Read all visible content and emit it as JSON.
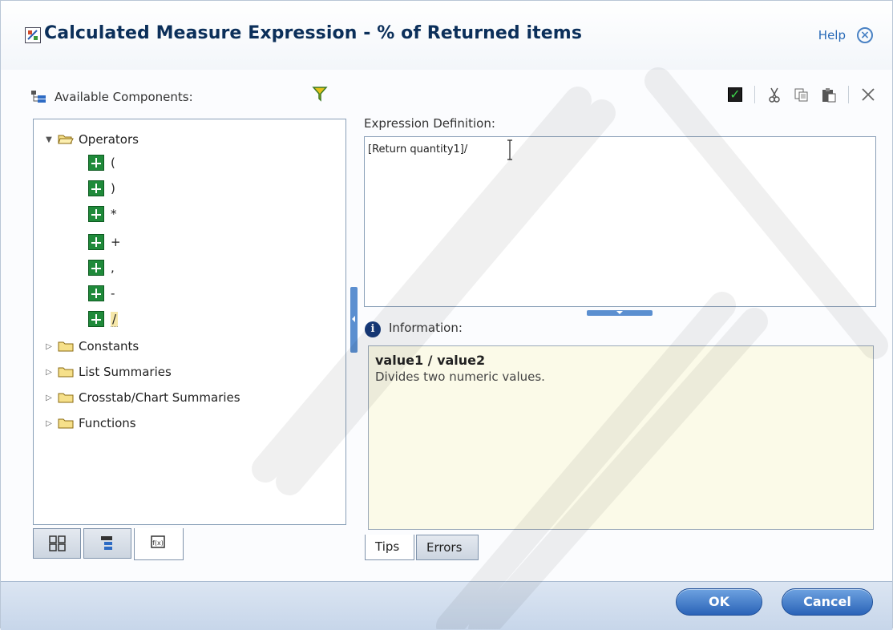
{
  "dialog": {
    "title": "Calculated Measure Expression - % of Returned items",
    "help_label": "Help",
    "close_glyph": "×"
  },
  "left_panel": {
    "available_label": "Available Components:",
    "tree": {
      "operators": {
        "label": "Operators",
        "items": [
          "(",
          ")",
          "*",
          "+",
          ",",
          "-",
          "/"
        ],
        "selected": "/"
      },
      "folders": [
        "Constants",
        "List Summaries",
        "Crosstab/Chart Summaries",
        "Functions"
      ]
    },
    "bottom_tab_icons": [
      "data-objects-icon",
      "hierarchy-icon",
      "function-icon"
    ]
  },
  "right_panel": {
    "toolbar_icons": [
      "validate-check-icon",
      "cut-icon",
      "copy-icon",
      "paste-icon",
      "clear-icon"
    ],
    "expression_label": "Expression Definition:",
    "expression_value": "[Return quantity1]/",
    "information_label": "Information:",
    "info_signature": "value1 / value2",
    "info_description": "Divides two numeric values.",
    "tabs": [
      "Tips",
      "Errors"
    ],
    "active_tab": "Tips"
  },
  "footer": {
    "ok_label": "OK",
    "cancel_label": "Cancel"
  },
  "colors": {
    "title": "#0b2f5a",
    "accent": "#2b63b8",
    "info_bg": "#fbfae8",
    "operator_icon": "#1f8a3a"
  }
}
